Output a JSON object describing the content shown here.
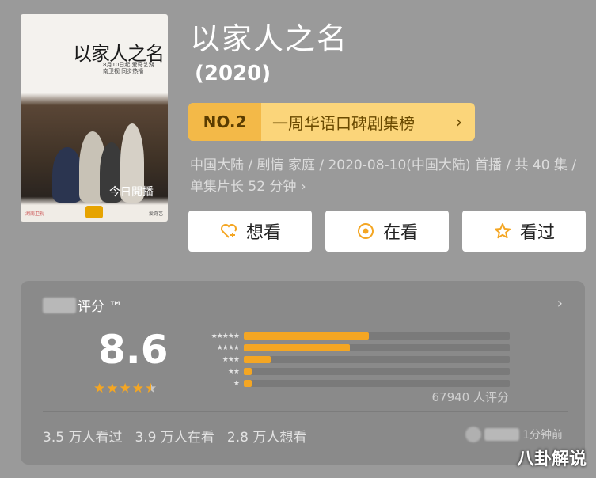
{
  "poster": {
    "title": "以家人之名",
    "subtitle": "8月10日起 爱奇艺湖南卫视 同步热播",
    "signature": "今日開播",
    "brand_left": "湖南卫视",
    "brand_right": "爱奇艺"
  },
  "show": {
    "title": "以家人之名",
    "year": "(2020)",
    "rank_no": "NO.2",
    "rank_label": "一周华语口碑剧集榜",
    "meta": "中国大陆 / 剧情 家庭 / 2020-08-10(中国大陆) 首播 / 共 40 集 / 单集片长 52 分钟 ›"
  },
  "actions": {
    "want": "想看",
    "watching": "在看",
    "watched": "看过"
  },
  "rating": {
    "header": "评分 ™",
    "score": "8.6",
    "stars_value": 4.5,
    "distribution": [
      {
        "stars": "★★★★★",
        "fraction": 0.47
      },
      {
        "stars": "★★★★",
        "fraction": 0.4
      },
      {
        "stars": "★★★",
        "fraction": 0.1
      },
      {
        "stars": "★★",
        "fraction": 0.03
      },
      {
        "stars": "★",
        "fraction": 0.03
      }
    ],
    "count": "67940 人评分"
  },
  "stats": {
    "watched": "3.5 万人看过",
    "watching": "3.9 万人在看",
    "want": "2.8 万人想看",
    "recent_time": "1分钟前"
  },
  "watermark": "八卦解说",
  "colors": {
    "accent": "#f4a623",
    "rank_bg": "#fbd57a",
    "background": "#9a9a9a"
  }
}
